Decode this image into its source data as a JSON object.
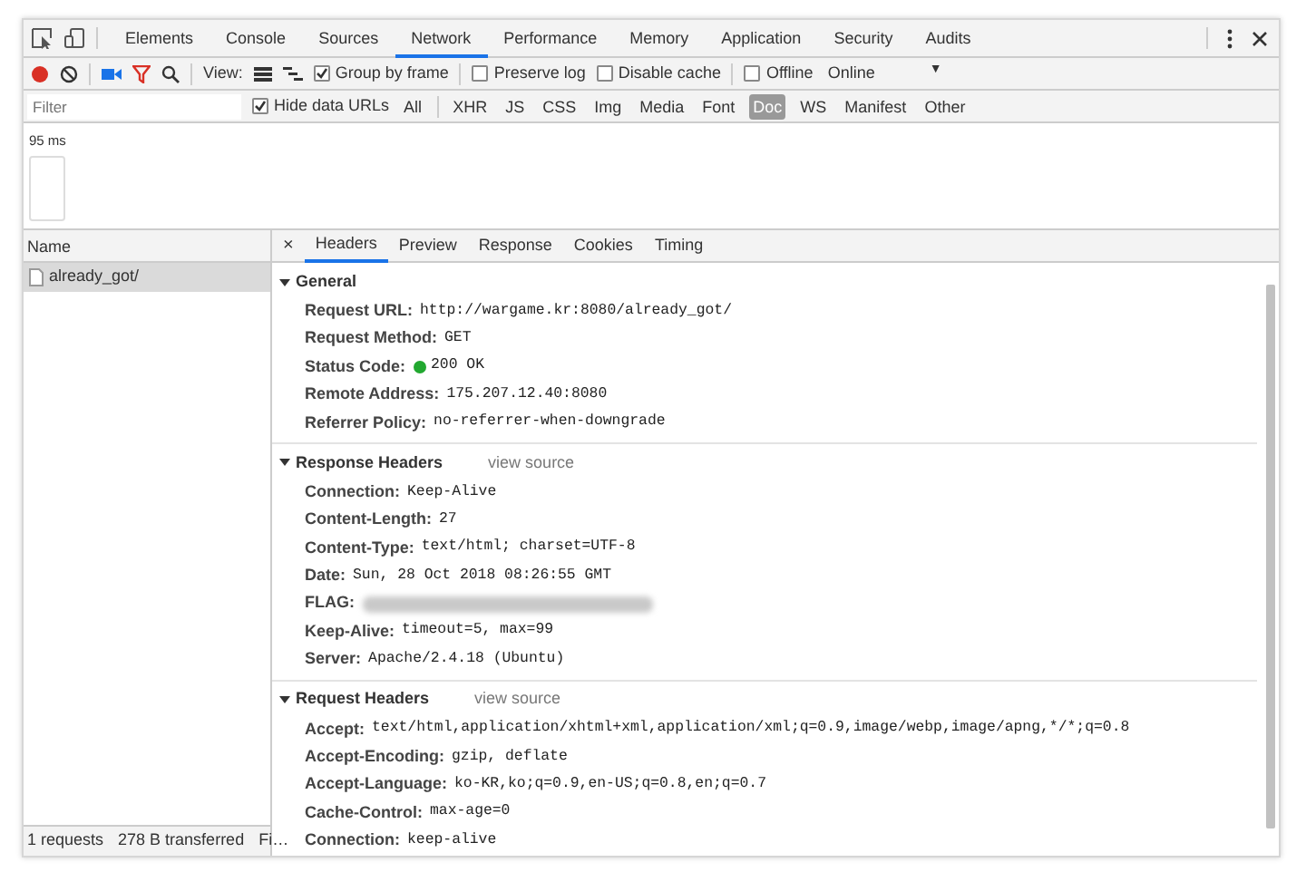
{
  "main_tabs": [
    {
      "label": "Elements",
      "selected": false
    },
    {
      "label": "Console",
      "selected": false
    },
    {
      "label": "Sources",
      "selected": false
    },
    {
      "label": "Network",
      "selected": true
    },
    {
      "label": "Performance",
      "selected": false
    },
    {
      "label": "Memory",
      "selected": false
    },
    {
      "label": "Application",
      "selected": false
    },
    {
      "label": "Security",
      "selected": false
    },
    {
      "label": "Audits",
      "selected": false
    }
  ],
  "toolbar": {
    "recording": true,
    "view_label": "View:",
    "checkboxes": [
      {
        "label": "Group by frame",
        "checked": true
      },
      {
        "label": "Preserve log",
        "checked": false
      },
      {
        "label": "Disable cache",
        "checked": false
      },
      {
        "label": "Offline",
        "checked": false
      }
    ],
    "throttle": "Online",
    "throttle_caret": "▼"
  },
  "filter": {
    "placeholder": "Filter",
    "hide_data_urls": {
      "label": "Hide data URLs",
      "checked": true
    },
    "types": [
      {
        "label": "All",
        "selected": false
      },
      {
        "label": "XHR",
        "selected": false
      },
      {
        "label": "JS",
        "selected": false
      },
      {
        "label": "CSS",
        "selected": false
      },
      {
        "label": "Img",
        "selected": false
      },
      {
        "label": "Media",
        "selected": false
      },
      {
        "label": "Font",
        "selected": false
      },
      {
        "label": "Doc",
        "selected": true
      },
      {
        "label": "WS",
        "selected": false
      },
      {
        "label": "Manifest",
        "selected": false
      },
      {
        "label": "Other",
        "selected": false
      }
    ]
  },
  "overview": {
    "time_label": "95 ms"
  },
  "requests": {
    "column": "Name",
    "rows": [
      {
        "name": "already_got/",
        "selected": true
      }
    ]
  },
  "status_bar": [
    "1 requests",
    "278 B transferred",
    "Fi…"
  ],
  "detail": {
    "close": "×",
    "tabs": [
      {
        "label": "Headers",
        "selected": true
      },
      {
        "label": "Preview",
        "selected": false
      },
      {
        "label": "Response",
        "selected": false
      },
      {
        "label": "Cookies",
        "selected": false
      },
      {
        "label": "Timing",
        "selected": false
      }
    ],
    "sections": [
      {
        "title": "General",
        "expanded": true,
        "rows": [
          {
            "kind": "text",
            "key": "Request URL:",
            "value": "http://wargame.kr:8080/already_got/"
          },
          {
            "kind": "text",
            "key": "Request Method:",
            "value": "GET"
          },
          {
            "kind": "status",
            "key": "Status Code:",
            "value": "200 OK",
            "color": "#22a830"
          },
          {
            "kind": "text",
            "key": "Remote Address:",
            "value": "175.207.12.40:8080"
          },
          {
            "kind": "text",
            "key": "Referrer Policy:",
            "value": "no-referrer-when-downgrade"
          }
        ]
      },
      {
        "title": "Response Headers",
        "link": "view source",
        "expanded": true,
        "rows": [
          {
            "kind": "text",
            "key": "Connection:",
            "value": "Keep-Alive"
          },
          {
            "kind": "text",
            "key": "Content-Length:",
            "value": "27"
          },
          {
            "kind": "text",
            "key": "Content-Type:",
            "value": "text/html; charset=UTF-8"
          },
          {
            "kind": "text",
            "key": "Date:",
            "value": "Sun, 28 Oct 2018 08:26:55 GMT"
          },
          {
            "kind": "redacted",
            "key": "FLAG:"
          },
          {
            "kind": "text",
            "key": "Keep-Alive:",
            "value": "timeout=5, max=99"
          },
          {
            "kind": "text",
            "key": "Server:",
            "value": "Apache/2.4.18 (Ubuntu)"
          }
        ]
      },
      {
        "title": "Request Headers",
        "link": "view source",
        "expanded": true,
        "rows": [
          {
            "kind": "text",
            "key": "Accept:",
            "value": "text/html,application/xhtml+xml,application/xml;q=0.9,image/webp,image/apng,*/*;q=0.8"
          },
          {
            "kind": "text",
            "key": "Accept-Encoding:",
            "value": "gzip, deflate"
          },
          {
            "kind": "text",
            "key": "Accept-Language:",
            "value": "ko-KR,ko;q=0.9,en-US;q=0.8,en;q=0.7"
          },
          {
            "kind": "text",
            "key": "Cache-Control:",
            "value": "max-age=0"
          },
          {
            "kind": "text",
            "key": "Connection:",
            "value": "keep-alive"
          }
        ]
      }
    ]
  }
}
